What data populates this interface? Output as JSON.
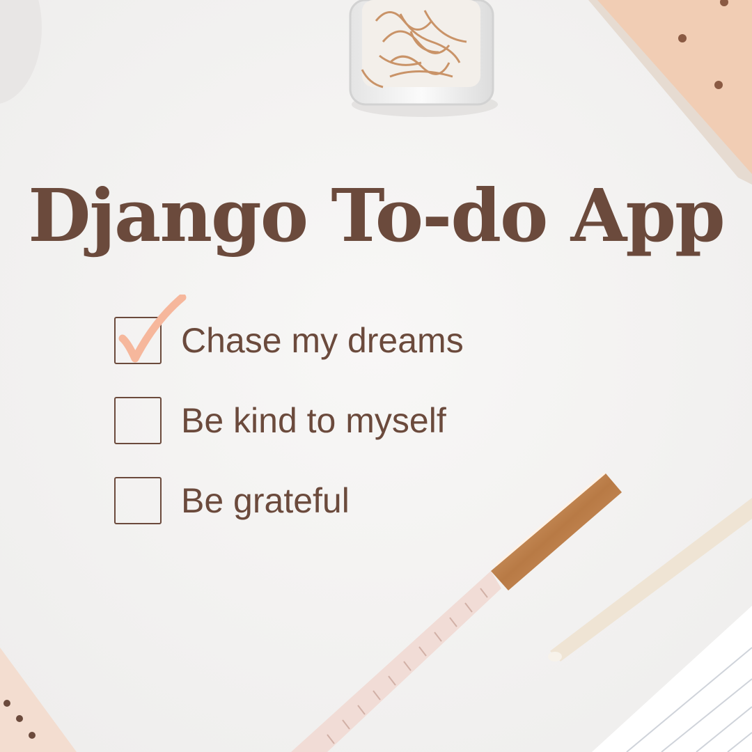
{
  "title": "Django To-do App",
  "colors": {
    "text": "#6b4a3c",
    "check": "#f6b79c",
    "background": "#f4f3f2"
  },
  "todos": [
    {
      "label": "Chase my dreams",
      "checked": true
    },
    {
      "label": "Be kind to myself",
      "checked": false
    },
    {
      "label": "Be grateful",
      "checked": false
    }
  ]
}
